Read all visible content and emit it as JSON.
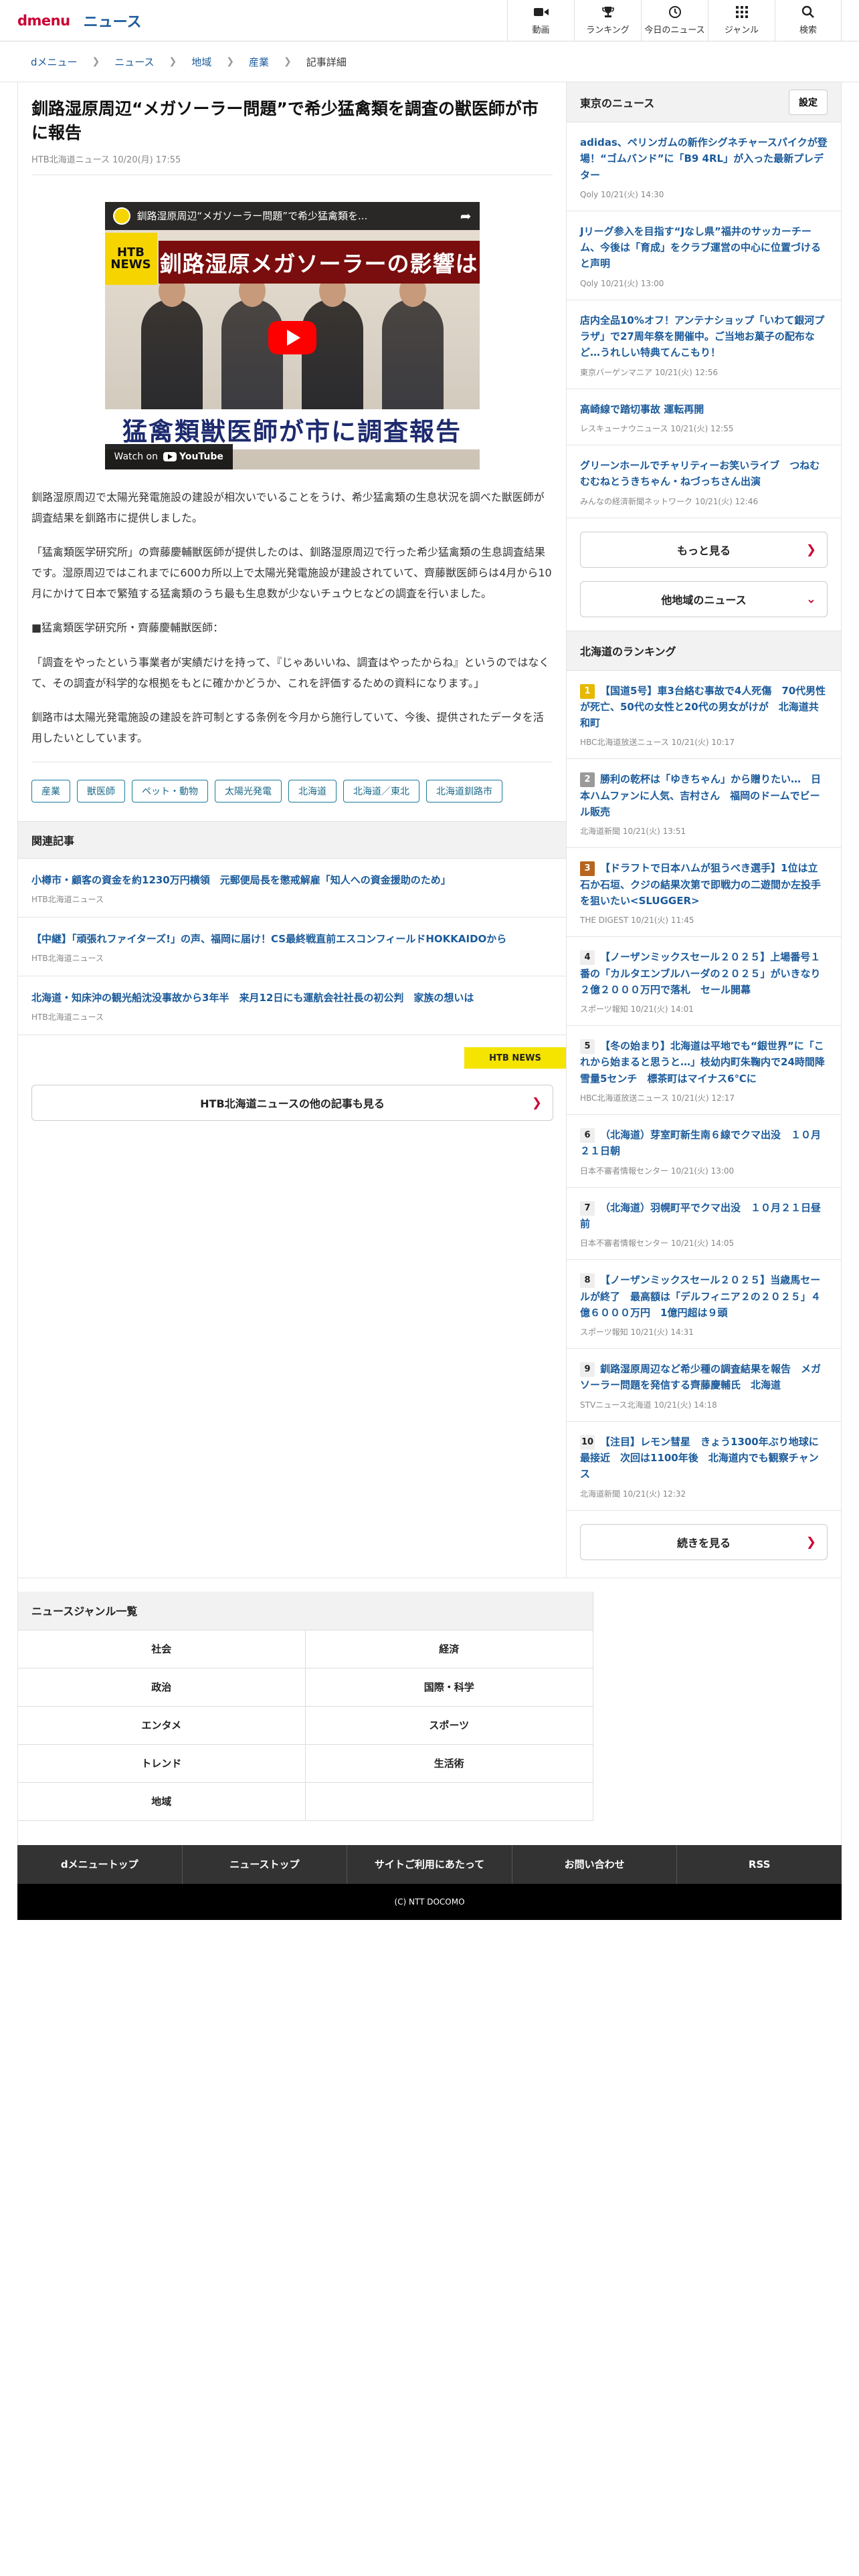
{
  "header": {
    "brand": "dmenu",
    "section": "ニュース",
    "nav": [
      {
        "label": "動画",
        "icon": "video-icon"
      },
      {
        "label": "ランキング",
        "icon": "trophy-icon"
      },
      {
        "label": "今日のニュース",
        "icon": "clock-icon"
      },
      {
        "label": "ジャンル",
        "icon": "grid-icon"
      },
      {
        "label": "検索",
        "icon": "search-icon"
      }
    ]
  },
  "breadcrumb": [
    "dメニュー",
    "ニュース",
    "地域",
    "産業",
    "記事詳細"
  ],
  "article": {
    "title": "釧路湿原周辺“メガソーラー問題”で希少猛禽類を調査の獣医師が市に報告",
    "meta": "HTB北海道ニュース 10/20(月) 17:55",
    "video": {
      "title": "釧路湿原周辺“メガソーラー問題”で希少猛禽類を...",
      "badge_line1": "HTB",
      "badge_line2": "NEWS",
      "banner": "釧路湿原メガソーラーの影響は",
      "caption": "猛禽類獣医師が市に調査報告",
      "watch_on": "Watch on",
      "youtube": "YouTube"
    },
    "paragraphs": [
      "釧路湿原周辺で太陽光発電施設の建設が相次いでいることをうけ、希少猛禽類の生息状況を調べた獣医師が調査結果を釧路市に提供しました。",
      "「猛禽類医学研究所」の齊藤慶輔獣医師が提供したのは、釧路湿原周辺で行った希少猛禽類の生息調査結果です。湿原周辺ではこれまでに600カ所以上で太陽光発電施設が建設されていて、齊藤獣医師らは4月から10月にかけて日本で繁殖する猛禽類のうち最も生息数が少ないチュウヒなどの調査を行いました。",
      "■猛禽類医学研究所・齊藤慶輔獣医師：",
      "「調査をやったという事業者が実績だけを持って、『じゃあいいね、調査はやったからね』というのではなくて、その調査が科学的な根拠をもとに確かかどうか、これを評価するための資料になります。」",
      "釧路市は太陽光発電施設の建設を許可制とする条例を今月から施行していて、今後、提供されたデータを活用したいとしています。"
    ],
    "tags": [
      "産業",
      "獣医師",
      "ペット・動物",
      "太陽光発電",
      "北海道",
      "北海道／東北",
      "北海道釧路市"
    ]
  },
  "related": {
    "heading": "関連記事",
    "items": [
      {
        "title": "小樽市・顧客の資金を約1230万円横領　元郵便局長を懲戒解雇「知人への資金援助のため」",
        "source": "HTB北海道ニュース"
      },
      {
        "title": "【中継】「頑張れファイターズ!」の声、福岡に届け！CS最終戦直前エスコンフィールドHOKKAIDOから",
        "source": "HTB北海道ニュース"
      },
      {
        "title": "北海道・知床沖の観光船沈没事故から3年半　来月12日にも運航会社社長の初公判　家族の想いは",
        "source": "HTB北海道ニュース"
      }
    ],
    "logo_text": "HTB NEWS",
    "more": "HTB北海道ニュースの他の記事も見る"
  },
  "sidebar": {
    "tokyo": {
      "heading": "東京のニュース",
      "setting": "設定",
      "items": [
        {
          "title": "adidas、ペリンガムの新作シグネチャースパイクが登場！“ゴムバンド”に「B9 4RL」が入った最新プレデター",
          "source": "Qoly 10/21(火) 14:30"
        },
        {
          "title": "Jリーグ参入を目指す“Jなし県”福井のサッカーチーム、今後は「育成」をクラブ運営の中心に位置づけると声明",
          "source": "Qoly 10/21(火) 13:00"
        },
        {
          "title": "店内全品10%オフ！アンテナショップ「いわて銀河プラザ」で27周年祭を開催中。ご当地お菓子の配布など…うれしい特典てんこもり！",
          "source": "東京バーゲンマニア 10/21(火) 12:56"
        },
        {
          "title": "高崎線で踏切事故 運転再開",
          "source": "レスキューナウニュース 10/21(火) 12:55"
        },
        {
          "title": "グリーンホールでチャリティーお笑いライブ　つねむむむねとうきちゃん・ねづっちさん出演",
          "source": "みんなの経済新聞ネットワーク 10/21(火) 12:46"
        }
      ],
      "more": "もっと見る",
      "other": "他地域のニュース"
    },
    "ranking": {
      "heading": "北海道のランキング",
      "items": [
        {
          "num": "1",
          "title": "【国道5号】車3台絡む事故で4人死傷　70代男性が死亡、50代の女性と20代の男女がけが　北海道共和町",
          "source": "HBC北海道放送ニュース 10/21(火) 10:17"
        },
        {
          "num": "2",
          "title": "勝利の乾杯は「ゆきちゃん」から贈りたい…　日本ハムファンに人気、吉村さん　福岡のドームでビール販売",
          "source": "北海道新聞 10/21(火) 13:51"
        },
        {
          "num": "3",
          "title": "【ドラフトで日本ハムが狙うべき選手】1位は立石か石垣、クジの結果次第で即戦力の二遊間か左投手を狙いたい<SLUGGER>",
          "source": "THE DIGEST 10/21(火) 11:45"
        },
        {
          "num": "4",
          "title": "【ノーザンミックスセール２０２５】上場番号１番の「カルタエンブルハーダの２０２５」がいきなり２億２０００万円で落札　セール開幕",
          "source": "スポーツ報知 10/21(火) 14:01"
        },
        {
          "num": "5",
          "title": "【冬の始まり】北海道は平地でも“銀世界”に「これから始まると思うと…」枝幼内町朱鞠内で24時間降雪量5センチ　標茶町はマイナス6℃に",
          "source": "HBC北海道放送ニュース 10/21(火) 12:17"
        },
        {
          "num": "6",
          "title": "（北海道）芽室町新生南６線でクマ出没　１０月２１日朝",
          "source": "日本不審者情報センター 10/21(火) 13:00"
        },
        {
          "num": "7",
          "title": "（北海道）羽幌町平でクマ出没　１０月２１日昼前",
          "source": "日本不審者情報センター 10/21(火) 14:05"
        },
        {
          "num": "8",
          "title": "【ノーザンミックスセール２０２５】当歳馬セールが終了　最高額は「デルフィニア２の２０２５」４億６０００万円　1億円超は９頭",
          "source": "スポーツ報知 10/21(火) 14:31"
        },
        {
          "num": "9",
          "title": "釧路湿原周辺など希少種の調査結果を報告　メガソーラー問題を発信する齊藤慶輔氏　北海道",
          "source": "STVニュース北海道 10/21(火) 14:18"
        },
        {
          "num": "10",
          "title": "【注目】レモン彗星　きょう1300年ぶり地球に最接近　次回は1100年後　北海道内でも観察チャンス",
          "source": "北海道新聞 10/21(火) 12:32"
        }
      ],
      "more": "続きを見る"
    }
  },
  "genres": {
    "heading": "ニュースジャンル一覧",
    "items": [
      "社会",
      "経済",
      "政治",
      "国際・科学",
      "エンタメ",
      "スポーツ",
      "トレンド",
      "生活術",
      "地域",
      ""
    ]
  },
  "footer": {
    "links": [
      "dメニュートップ",
      "ニューストップ",
      "サイトご利用にあたって",
      "お問い合わせ",
      "RSS"
    ],
    "copyright": "(C) NTT DOCOMO"
  },
  "colors": {
    "brand_red": "#cc0033",
    "link_blue": "#1a5a9a",
    "rank1": "#e6b800",
    "rank2": "#9a9a9a",
    "rank3": "#b7651e"
  }
}
